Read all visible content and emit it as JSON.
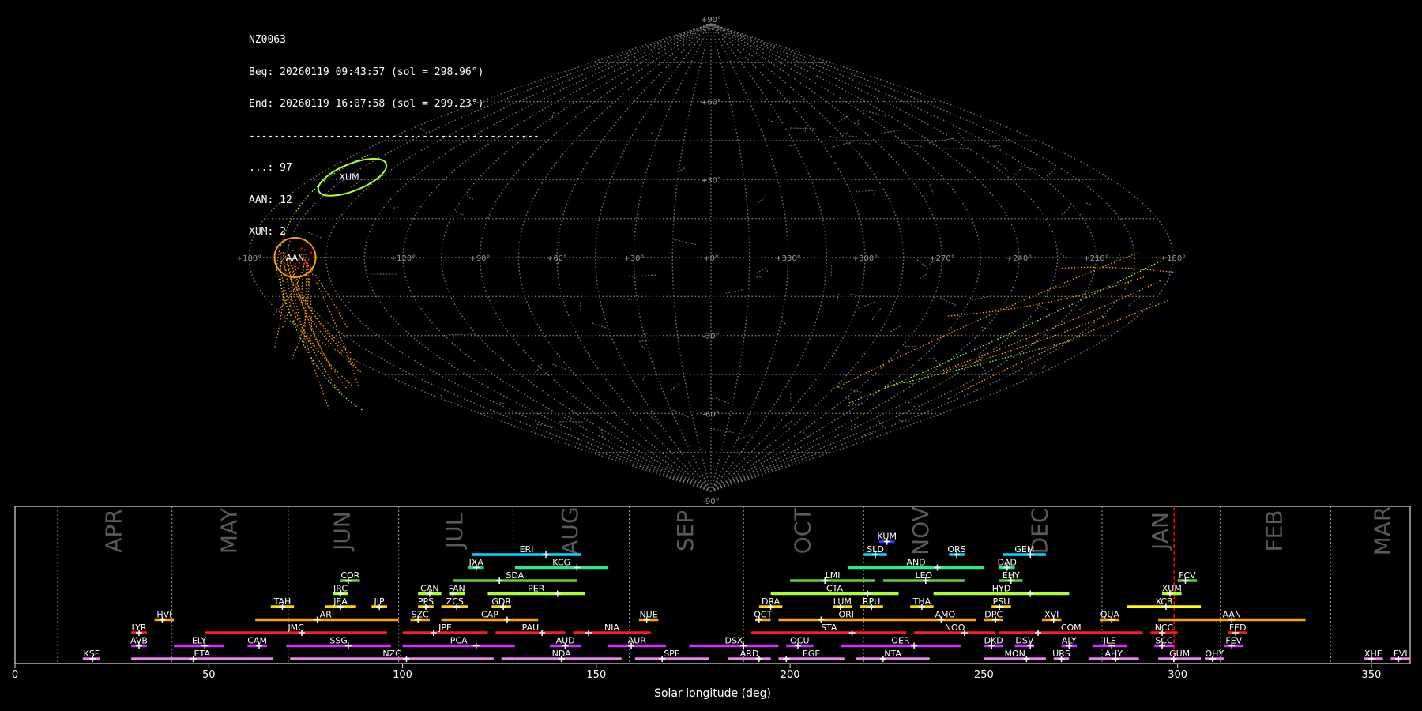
{
  "info": {
    "camera": "NZ0063",
    "beg": "Beg: 20260119 09:43:57 (sol = 298.96°)",
    "end": "End: 20260119 16:07:58 (sol = 299.23°)",
    "separator": "-----------------------------------------------",
    "counts": [
      "...: 97",
      "AAN: 12",
      "XUM: 2"
    ]
  },
  "sky_map": {
    "lon_labels": [
      "+180°",
      "+120°",
      "+90°",
      "+60°",
      "+30°",
      "+0°",
      "+330°",
      "+300°",
      "+270°",
      "+240°",
      "+210°",
      "+180°"
    ],
    "lat_labels": [
      "+90°",
      "+60°",
      "+30°",
      "-30°",
      "-60°",
      "-90°"
    ],
    "colors": {
      "grid": "#777777",
      "sporadic": "#888888",
      "AAN": "#ffa500",
      "XUM": "#adff2f",
      "cluster": "#ff0000"
    },
    "shower_circles": [
      {
        "code": "AAN",
        "color": "#ffa500"
      },
      {
        "code": "XUM",
        "color": "#adff2f"
      }
    ]
  },
  "chart_data": {
    "type": "timeline",
    "xlabel": "Solar longitude (deg)",
    "xlim": [
      0,
      360
    ],
    "xticks": [
      "0",
      "50",
      "100",
      "150",
      "200",
      "250",
      "300",
      "350"
    ],
    "months": [
      {
        "name": "APR",
        "start": 11,
        "end": 40.5
      },
      {
        "name": "MAY",
        "start": 40.5,
        "end": 70.5
      },
      {
        "name": "JUN",
        "start": 70.5,
        "end": 99
      },
      {
        "name": "JUL",
        "start": 99,
        "end": 128.5
      },
      {
        "name": "AUG",
        "start": 128.5,
        "end": 158.5
      },
      {
        "name": "SEP",
        "start": 158.5,
        "end": 188
      },
      {
        "name": "OCT",
        "start": 188,
        "end": 219
      },
      {
        "name": "NOV",
        "start": 219,
        "end": 249
      },
      {
        "name": "DEC",
        "start": 249,
        "end": 280.5
      },
      {
        "name": "JAN",
        "start": 280.5,
        "end": 311
      },
      {
        "name": "FEB",
        "start": 311,
        "end": 339.5
      },
      {
        "name": "MAR",
        "start": 339.5,
        "end": 371
      }
    ],
    "current_sol": 299.1,
    "showers": [
      {
        "code": "KSF",
        "row": 0,
        "start": 17.5,
        "end": 22,
        "peak": 20,
        "color": "#ee82ee"
      },
      {
        "code": "ETA",
        "row": 0,
        "start": 30,
        "end": 66.5,
        "peak": 46,
        "color": "#ee82ee"
      },
      {
        "code": "NZC",
        "row": 0,
        "start": 71,
        "end": 123.5,
        "peak": 101,
        "color": "#ee82ee"
      },
      {
        "code": "NDA",
        "row": 0,
        "start": 125.5,
        "end": 156.5,
        "peak": 141,
        "color": "#ee82ee"
      },
      {
        "code": "SPE",
        "row": 0,
        "start": 160,
        "end": 179,
        "peak": 167,
        "color": "#ee82ee"
      },
      {
        "code": "ARD",
        "row": 0,
        "start": 184,
        "end": 195,
        "peak": 192,
        "color": "#ee82ee"
      },
      {
        "code": "EGE",
        "row": 0,
        "start": 197,
        "end": 214,
        "peak": 199,
        "color": "#ee82ee"
      },
      {
        "code": "NTA",
        "row": 0,
        "start": 217,
        "end": 236,
        "peak": 224,
        "color": "#ee82ee"
      },
      {
        "code": "MON",
        "row": 0,
        "start": 250,
        "end": 266,
        "peak": 261,
        "color": "#ee82ee"
      },
      {
        "code": "URS",
        "row": 0,
        "start": 268,
        "end": 272,
        "peak": 270,
        "color": "#ee82ee"
      },
      {
        "code": "AHY",
        "row": 0,
        "start": 277,
        "end": 290,
        "peak": 284,
        "color": "#ee82ee"
      },
      {
        "code": "GUM",
        "row": 0,
        "start": 295,
        "end": 306,
        "peak": 299,
        "color": "#ee82ee"
      },
      {
        "code": "OHY",
        "row": 0,
        "start": 307,
        "end": 312,
        "peak": 309,
        "color": "#ee82ee"
      },
      {
        "code": "XHE",
        "row": 0,
        "start": 348,
        "end": 353,
        "peak": 350,
        "color": "#ee82ee"
      },
      {
        "code": "EVI",
        "row": 0,
        "start": 355,
        "end": 360,
        "peak": 357,
        "color": "#ee82ee"
      },
      {
        "code": "AVB",
        "row": 1,
        "start": 30,
        "end": 34,
        "peak": 32,
        "color": "#cc33ff"
      },
      {
        "code": "ELY",
        "row": 1,
        "start": 41,
        "end": 54,
        "peak": 49,
        "color": "#cc33ff"
      },
      {
        "code": "CAM",
        "row": 1,
        "start": 60,
        "end": 65,
        "peak": 63,
        "color": "#cc33ff"
      },
      {
        "code": "SSG",
        "row": 1,
        "start": 70,
        "end": 97,
        "peak": 86,
        "color": "#cc33ff"
      },
      {
        "code": "PCA",
        "row": 1,
        "start": 100,
        "end": 129,
        "peak": 119,
        "color": "#cc33ff"
      },
      {
        "code": "AUD",
        "row": 1,
        "start": 138,
        "end": 146,
        "peak": 142,
        "color": "#cc33ff"
      },
      {
        "code": "AUR",
        "row": 1,
        "start": 153,
        "end": 168,
        "peak": 159,
        "color": "#cc33ff"
      },
      {
        "code": "DSX",
        "row": 1,
        "start": 174,
        "end": 197,
        "peak": 188,
        "color": "#cc33ff"
      },
      {
        "code": "OCU",
        "row": 1,
        "start": 199,
        "end": 206,
        "peak": 202,
        "color": "#cc33ff"
      },
      {
        "code": "OER",
        "row": 1,
        "start": 213,
        "end": 244,
        "peak": 232,
        "color": "#cc33ff"
      },
      {
        "code": "DKD",
        "row": 1,
        "start": 250,
        "end": 255,
        "peak": 252,
        "color": "#cc33ff"
      },
      {
        "code": "DSV",
        "row": 1,
        "start": 258,
        "end": 263,
        "peak": 262,
        "color": "#cc33ff"
      },
      {
        "code": "ALY",
        "row": 1,
        "start": 270,
        "end": 274,
        "peak": 272,
        "color": "#cc33ff"
      },
      {
        "code": "JLE",
        "row": 1,
        "start": 278,
        "end": 287,
        "peak": 283,
        "color": "#cc33ff"
      },
      {
        "code": "SCC",
        "row": 1,
        "start": 294,
        "end": 299,
        "peak": 296,
        "color": "#cc33ff"
      },
      {
        "code": "FEV",
        "row": 1,
        "start": 312,
        "end": 317,
        "peak": 314,
        "color": "#cc33ff"
      },
      {
        "code": "LYR",
        "row": 2,
        "start": 30,
        "end": 34,
        "peak": 32,
        "color": "#ff1a1a"
      },
      {
        "code": "JMC",
        "row": 2,
        "start": 49,
        "end": 96,
        "peak": 74,
        "color": "#ff1a1a"
      },
      {
        "code": "JPE",
        "row": 2,
        "start": 100,
        "end": 122,
        "peak": 108,
        "color": "#ff1a1a"
      },
      {
        "code": "PAU",
        "row": 2,
        "start": 124,
        "end": 142,
        "peak": 136,
        "color": "#ff1a1a"
      },
      {
        "code": "NIA",
        "row": 2,
        "start": 144,
        "end": 164,
        "peak": 148,
        "color": "#ff1a1a"
      },
      {
        "code": "STA",
        "row": 2,
        "start": 190,
        "end": 230,
        "peak": 216,
        "color": "#ff1a1a"
      },
      {
        "code": "NOO",
        "row": 2,
        "start": 232,
        "end": 253,
        "peak": 245,
        "color": "#ff1a1a"
      },
      {
        "code": "COM",
        "row": 2,
        "start": 254,
        "end": 291,
        "peak": 264,
        "color": "#ff1a1a"
      },
      {
        "code": "NCC",
        "row": 2,
        "start": 293,
        "end": 300,
        "peak": 296,
        "color": "#ff1a1a"
      },
      {
        "code": "FED",
        "row": 2,
        "start": 313,
        "end": 318,
        "peak": 315,
        "color": "#ff1a1a"
      },
      {
        "code": "HVI",
        "row": 3,
        "start": 36,
        "end": 41,
        "peak": 38,
        "color": "#ffa500"
      },
      {
        "code": "ARI",
        "row": 3,
        "start": 62,
        "end": 99,
        "peak": 78,
        "color": "#ffa500"
      },
      {
        "code": "SZC",
        "row": 3,
        "start": 102,
        "end": 107,
        "peak": 104,
        "color": "#ffa500"
      },
      {
        "code": "CAP",
        "row": 3,
        "start": 110,
        "end": 135,
        "peak": 127,
        "color": "#ffa500"
      },
      {
        "code": "NUE",
        "row": 3,
        "start": 161,
        "end": 166,
        "peak": 163,
        "color": "#ffa500"
      },
      {
        "code": "OCT",
        "row": 3,
        "start": 191,
        "end": 195,
        "peak": 192,
        "color": "#ffa500"
      },
      {
        "code": "ORI",
        "row": 3,
        "start": 197,
        "end": 232,
        "peak": 208,
        "color": "#ffa500"
      },
      {
        "code": "AMO",
        "row": 3,
        "start": 232,
        "end": 248,
        "peak": 239,
        "color": "#ffa500"
      },
      {
        "code": "DPC",
        "row": 3,
        "start": 250,
        "end": 255,
        "peak": 253,
        "color": "#ffa500"
      },
      {
        "code": "XVI",
        "row": 3,
        "start": 265,
        "end": 270,
        "peak": 268,
        "color": "#ffa500"
      },
      {
        "code": "QUA",
        "row": 3,
        "start": 280,
        "end": 285,
        "peak": 283,
        "color": "#ffa500"
      },
      {
        "code": "AAN",
        "row": 3,
        "start": 295,
        "end": 333,
        "peak": 314,
        "color": "#ffa500"
      },
      {
        "code": "TAH",
        "row": 4,
        "start": 66,
        "end": 72,
        "peak": 69,
        "color": "#ffd700"
      },
      {
        "code": "JEA",
        "row": 4,
        "start": 80,
        "end": 88,
        "peak": 84,
        "color": "#ffd700"
      },
      {
        "code": "JIP",
        "row": 4,
        "start": 92,
        "end": 96,
        "peak": 94,
        "color": "#ffd700"
      },
      {
        "code": "PPS",
        "row": 4,
        "start": 104,
        "end": 108,
        "peak": 106,
        "color": "#ffd700"
      },
      {
        "code": "ZCS",
        "row": 4,
        "start": 110,
        "end": 117,
        "peak": 114,
        "color": "#ffd700"
      },
      {
        "code": "GDR",
        "row": 4,
        "start": 123,
        "end": 128,
        "peak": 126,
        "color": "#ffd700"
      },
      {
        "code": "DRA",
        "row": 4,
        "start": 192,
        "end": 198,
        "peak": 195,
        "color": "#ffd700"
      },
      {
        "code": "LUM",
        "row": 4,
        "start": 211,
        "end": 216,
        "peak": 213,
        "color": "#ffd700"
      },
      {
        "code": "RPU",
        "row": 4,
        "start": 218,
        "end": 224,
        "peak": 221,
        "color": "#ffd700"
      },
      {
        "code": "THA",
        "row": 4,
        "start": 231,
        "end": 237,
        "peak": 234,
        "color": "#ffd700"
      },
      {
        "code": "PSU",
        "row": 4,
        "start": 252,
        "end": 257,
        "peak": 254,
        "color": "#ffd700"
      },
      {
        "code": "XCB",
        "row": 4,
        "start": 287,
        "end": 306,
        "peak": 297,
        "color": "#ffff00"
      },
      {
        "code": "JRC",
        "row": 5,
        "start": 82,
        "end": 86,
        "peak": 84,
        "color": "#adff2f"
      },
      {
        "code": "CAN",
        "row": 5,
        "start": 104,
        "end": 110,
        "peak": 107,
        "color": "#adff2f"
      },
      {
        "code": "FAN",
        "row": 5,
        "start": 112,
        "end": 116,
        "peak": 113,
        "color": "#adff2f"
      },
      {
        "code": "PER",
        "row": 5,
        "start": 122,
        "end": 147,
        "peak": 140,
        "color": "#adff2f"
      },
      {
        "code": "CTA",
        "row": 5,
        "start": 195,
        "end": 228,
        "peak": 220,
        "color": "#adff2f"
      },
      {
        "code": "HYD",
        "row": 5,
        "start": 237,
        "end": 272,
        "peak": 262,
        "color": "#adff2f"
      },
      {
        "code": "XUM",
        "row": 5,
        "start": 296,
        "end": 301,
        "peak": 298,
        "color": "#adff2f"
      },
      {
        "code": "COR",
        "row": 6,
        "start": 84,
        "end": 89,
        "peak": 86,
        "color": "#66cc33"
      },
      {
        "code": "SDA",
        "row": 6,
        "start": 113,
        "end": 145,
        "peak": 125,
        "color": "#66cc33"
      },
      {
        "code": "LMI",
        "row": 6,
        "start": 200,
        "end": 222,
        "peak": 209,
        "color": "#66cc33"
      },
      {
        "code": "LEO",
        "row": 6,
        "start": 224,
        "end": 245,
        "peak": 235,
        "color": "#66cc33"
      },
      {
        "code": "EHY",
        "row": 6,
        "start": 254,
        "end": 260,
        "peak": 257,
        "color": "#66cc33"
      },
      {
        "code": "FCV",
        "row": 6,
        "start": 300,
        "end": 305,
        "peak": 302,
        "color": "#66cc33"
      },
      {
        "code": "JXA",
        "row": 7,
        "start": 117,
        "end": 121,
        "peak": 119,
        "color": "#22cc88"
      },
      {
        "code": "KCG",
        "row": 7,
        "start": 129,
        "end": 153,
        "peak": 145,
        "color": "#22ee88"
      },
      {
        "code": "AND",
        "row": 7,
        "start": 215,
        "end": 250,
        "peak": 238,
        "color": "#22ee88"
      },
      {
        "code": "DAD",
        "row": 7,
        "start": 254,
        "end": 258,
        "peak": 256,
        "color": "#22ee88"
      },
      {
        "code": "ERI",
        "row": 8,
        "start": 118,
        "end": 146,
        "peak": 137,
        "color": "#00ddff"
      },
      {
        "code": "SLD",
        "row": 8,
        "start": 219,
        "end": 225,
        "peak": 222,
        "color": "#00ddff"
      },
      {
        "code": "ORS",
        "row": 8,
        "start": 241,
        "end": 245,
        "peak": 243,
        "color": "#00ddff"
      },
      {
        "code": "GEM",
        "row": 8,
        "start": 255,
        "end": 266,
        "peak": 262,
        "color": "#00ddff"
      },
      {
        "code": "KUM",
        "row": 9,
        "start": 223,
        "end": 227,
        "peak": 225,
        "color": "#3333ff"
      }
    ]
  }
}
